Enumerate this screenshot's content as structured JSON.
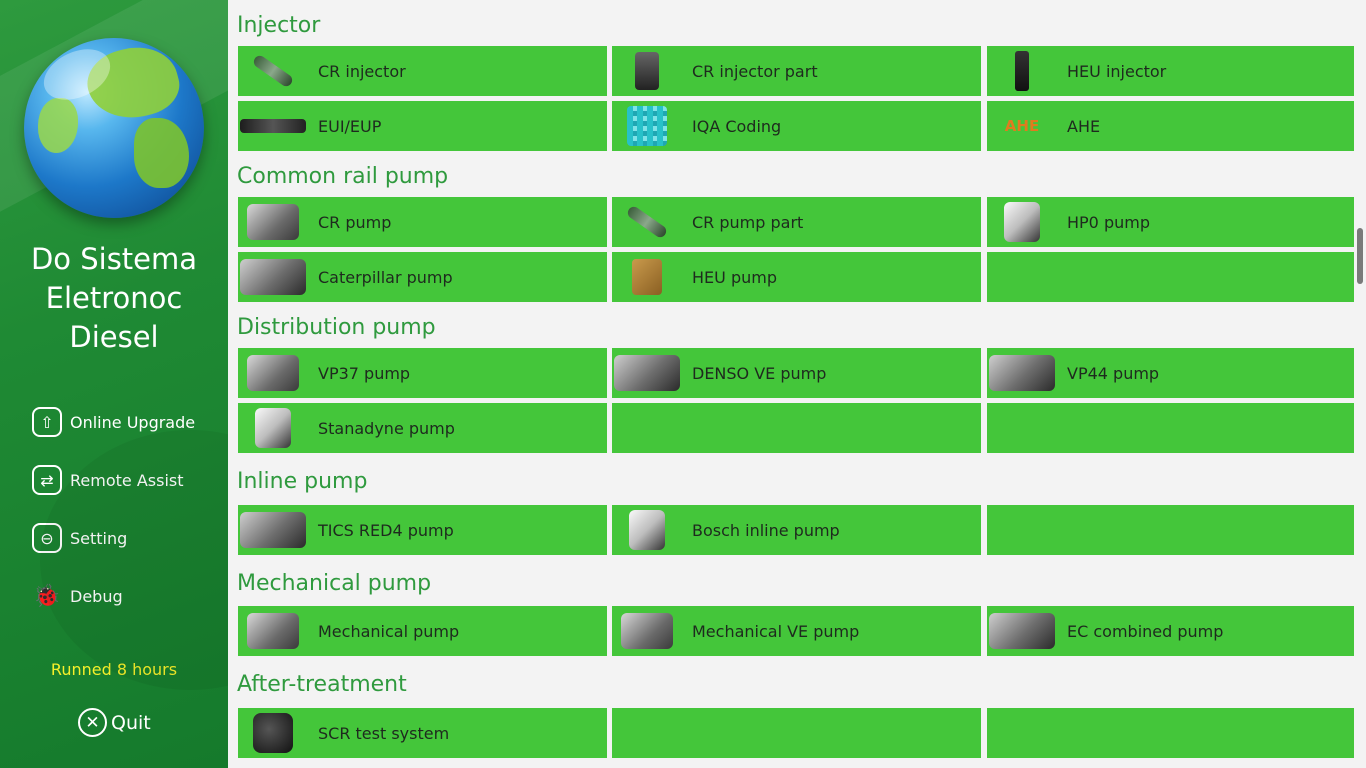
{
  "brand": {
    "line1": "Do Sistema",
    "line2": "Eletronoc",
    "line3": "Diesel"
  },
  "menu": [
    {
      "label": "Online Upgrade",
      "icon": "upload-icon"
    },
    {
      "label": "Remote Assist",
      "icon": "swap-icon"
    },
    {
      "label": "Setting",
      "icon": "toggle-icon"
    },
    {
      "label": "Debug",
      "icon": "bug-icon"
    }
  ],
  "status": {
    "runned": "Runned 8 hours"
  },
  "quit": {
    "label": "Quit"
  },
  "sections": [
    {
      "title": "Injector",
      "items": [
        "CR injector",
        "CR injector part",
        "HEU injector",
        "EUI/EUP",
        "IQA Coding",
        "AHE"
      ]
    },
    {
      "title": "Common rail pump",
      "items": [
        "CR pump",
        "CR pump part",
        "HP0 pump",
        "Caterpillar pump",
        "HEU pump",
        ""
      ]
    },
    {
      "title": "Distribution pump",
      "items": [
        "VP37 pump",
        "DENSO VE pump",
        "VP44 pump",
        "Stanadyne pump",
        "",
        ""
      ]
    },
    {
      "title": "Inline pump",
      "items": [
        "TICS RED4 pump",
        "Bosch inline pump",
        ""
      ]
    },
    {
      "title": "Mechanical pump",
      "items": [
        "Mechanical pump",
        "Mechanical VE pump",
        "EC combined pump"
      ]
    },
    {
      "title": "After-treatment",
      "items": [
        "SCR test system",
        "",
        ""
      ]
    }
  ],
  "thumb_text": {
    "ahe": "AHE"
  },
  "colors": {
    "sidebar": "#1f8a34",
    "tile": "#44c63a",
    "section_title": "#2f9a3e",
    "runned": "#f5ef2a"
  }
}
